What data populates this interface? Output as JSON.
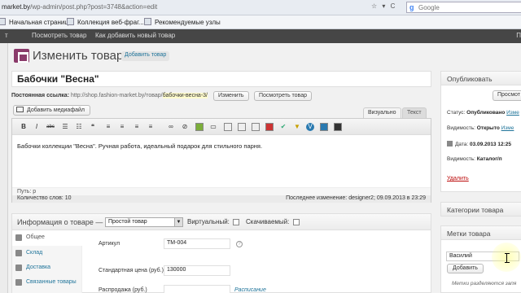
{
  "browser": {
    "url_host": "market.by",
    "url_path": "/wp-admin/post.php?post=3748&action=edit",
    "nav_controls": "☆ ▾ C",
    "search_placeholder": "Google"
  },
  "bookmarks": [
    {
      "label": "Начальная страница"
    },
    {
      "label": "Коллекция веб-фраг..."
    },
    {
      "label": "Рекомендуемые узлы"
    }
  ],
  "admin_bar": {
    "items": [
      "Посмотреть товар",
      "Как добавить новый товар"
    ],
    "right": "П"
  },
  "header": {
    "title": "Изменить товар",
    "add_new": "Добавить товар"
  },
  "post": {
    "title": "Бабочки \"Весна\"",
    "permalink_label": "Постоянная ссылка:",
    "permalink_base": "http://shop.fashion-market.by/товар/",
    "permalink_slug": "бабочки-весна-3/",
    "change_button": "Изменить",
    "view_button": "Посмотреть товар"
  },
  "editor": {
    "add_media": "Добавить медиафайл",
    "tab_visual": "Визуально",
    "tab_text": "Текст",
    "content": "Бабочки коллекции \"Весна\". Ручная работа, идеальный подарок для стильного парня.",
    "path": "Путь: p",
    "word_count": "Количество слов: 10",
    "last_edit": "Последнее изменение: designer2; 09.09.2013 в 23:29",
    "toolbar": [
      "B",
      "I",
      "abc",
      "ul",
      "ol",
      "quote",
      "align-left",
      "align-center",
      "align-right",
      "link",
      "unlink",
      "image",
      "more",
      "table",
      "embed",
      "video",
      "check",
      "v",
      "gallery",
      "fullscreen"
    ]
  },
  "product_data": {
    "title": "Информация о товаре —",
    "type_value": "Простой товар",
    "virtual_label": "Виртуальный:",
    "downloadable_label": "Скачиваемый:",
    "tabs": [
      {
        "label": "Общее",
        "icon": "gear-icon"
      },
      {
        "label": "Склад",
        "icon": "box-icon"
      },
      {
        "label": "Доставка",
        "icon": "truck-icon"
      },
      {
        "label": "Связанные товары",
        "icon": "link-icon"
      }
    ],
    "sku_label": "Артикул",
    "sku_value": "ТМ-004",
    "regular_price_label": "Стандартная цена (руб.)",
    "regular_price_value": "130000",
    "sale_price_label": "Распродажа (руб.)",
    "sale_price_value": "",
    "schedule_link": "Расписание"
  },
  "sidebar": {
    "publish": {
      "title": "Опубликовать",
      "preview_button": "Просмот",
      "status_label": "Статус:",
      "status_value": "Опубликовано",
      "status_link": "Изме",
      "visibility_label": "Видимость:",
      "visibility_value": "Открыто",
      "visibility_link": "Изме",
      "date_label": "Дата:",
      "date_value": "03.09.2013 12:25",
      "catalog_label": "Видимость:",
      "catalog_value": "Каталог/п",
      "delete_link": "Удалить"
    },
    "categories": {
      "title": "Категории товара"
    },
    "tags": {
      "title": "Метки товара",
      "input_value": "Василий",
      "add_button": "Добавить",
      "hint": "Метки разделяются запя"
    }
  }
}
